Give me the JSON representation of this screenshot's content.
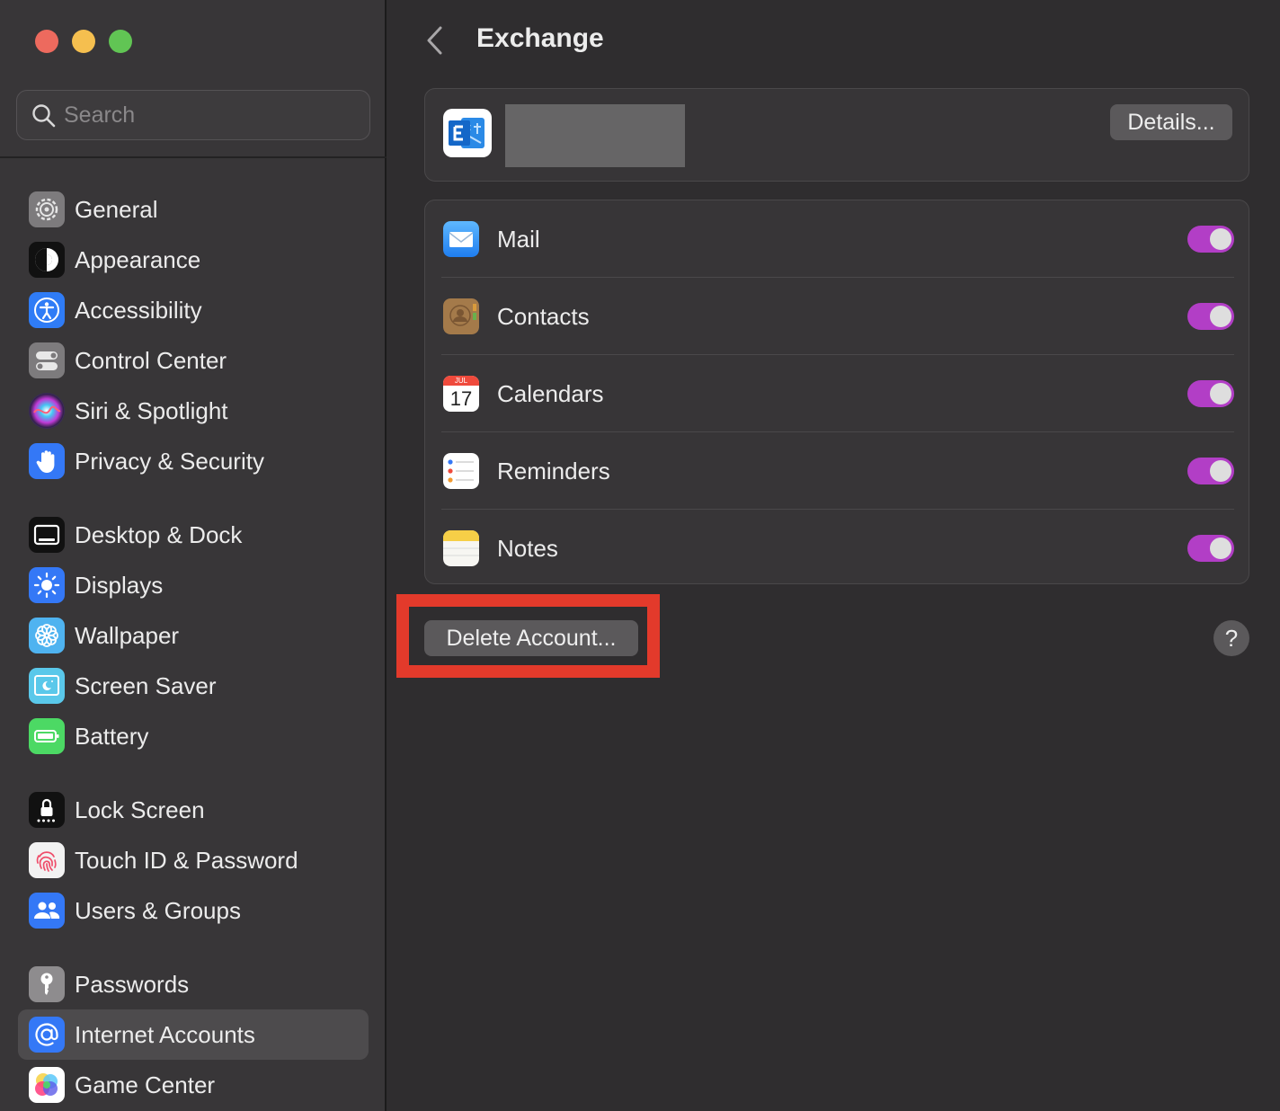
{
  "window": {
    "controls": [
      "close",
      "minimize",
      "zoom"
    ]
  },
  "search": {
    "placeholder": "Search"
  },
  "sidebar": {
    "items": [
      {
        "label": "General",
        "icon": "gear-icon",
        "color": "#7d7b7d"
      },
      {
        "label": "Appearance",
        "icon": "appearance-icon",
        "color": "#111111"
      },
      {
        "label": "Accessibility",
        "icon": "accessibility-icon",
        "color": "#2f7cf6"
      },
      {
        "label": "Control Center",
        "icon": "control-center-icon",
        "color": "#7d7b7d"
      },
      {
        "label": "Siri & Spotlight",
        "icon": "siri-icon",
        "color": "#3a2a5a"
      },
      {
        "label": "Privacy & Security",
        "icon": "hand-icon",
        "color": "#3478f6"
      },
      {
        "label": "Desktop & Dock",
        "icon": "dock-icon",
        "color": "#111111"
      },
      {
        "label": "Displays",
        "icon": "sun-icon",
        "color": "#3478f6"
      },
      {
        "label": "Wallpaper",
        "icon": "flower-icon",
        "color": "#4fb3f0"
      },
      {
        "label": "Screen Saver",
        "icon": "screen-saver-icon",
        "color": "#5ac8ea"
      },
      {
        "label": "Battery",
        "icon": "battery-icon",
        "color": "#4cd964"
      },
      {
        "label": "Lock Screen",
        "icon": "lock-icon",
        "color": "#111111"
      },
      {
        "label": "Touch ID & Password",
        "icon": "fingerprint-icon",
        "color": "#f2f2f2"
      },
      {
        "label": "Users & Groups",
        "icon": "users-icon",
        "color": "#3478f6"
      },
      {
        "label": "Passwords",
        "icon": "key-icon",
        "color": "#8e8c8e"
      },
      {
        "label": "Internet Accounts",
        "icon": "at-icon",
        "color": "#3478f6",
        "selected": true
      },
      {
        "label": "Game Center",
        "icon": "game-center-icon",
        "color": "#ffffff"
      }
    ]
  },
  "main": {
    "title": "Exchange",
    "account": {
      "details_label": "Details..."
    },
    "services": [
      {
        "label": "Mail",
        "icon": "mail-icon",
        "enabled": true
      },
      {
        "label": "Contacts",
        "icon": "contacts-icon",
        "enabled": true
      },
      {
        "label": "Calendars",
        "icon": "calendar-icon",
        "enabled": true,
        "calendar_month": "JUL",
        "calendar_day": "17"
      },
      {
        "label": "Reminders",
        "icon": "reminders-icon",
        "enabled": true
      },
      {
        "label": "Notes",
        "icon": "notes-icon",
        "enabled": true
      }
    ],
    "delete_label": "Delete Account...",
    "help_label": "?"
  },
  "colors": {
    "toggle_on": "#b23ec6",
    "highlight": "#e33a2b",
    "accent": "#3478f6"
  }
}
